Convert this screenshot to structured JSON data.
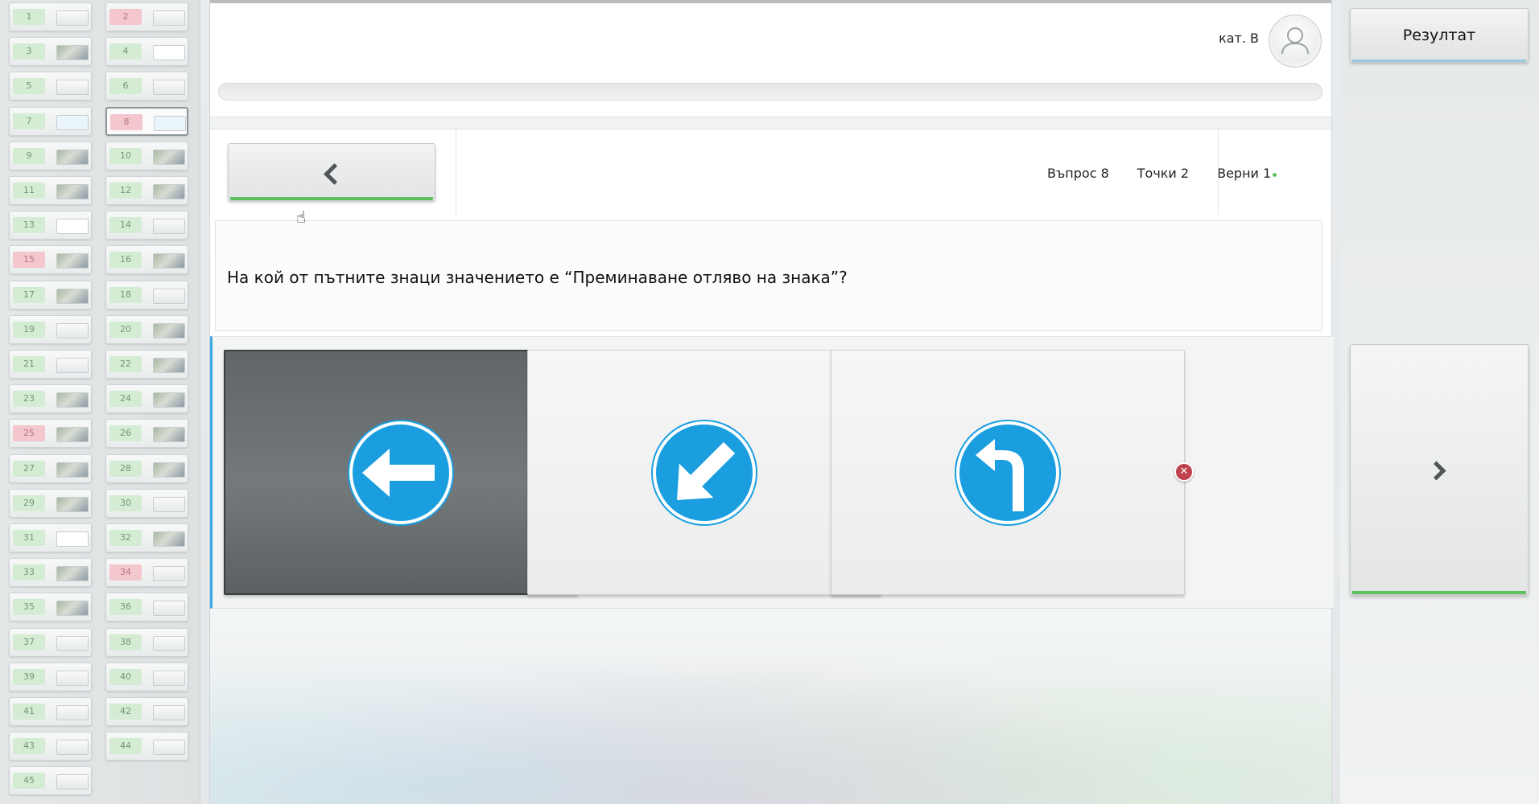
{
  "sidebar": {
    "tiles": [
      {
        "num": "1",
        "state": "green",
        "thumb": "plain"
      },
      {
        "num": "2",
        "state": "red",
        "thumb": "plain"
      },
      {
        "num": "3",
        "state": "green",
        "thumb": "pic"
      },
      {
        "num": "4",
        "state": "green",
        "thumb": "sign"
      },
      {
        "num": "5",
        "state": "green",
        "thumb": "plain"
      },
      {
        "num": "6",
        "state": "green",
        "thumb": "plain"
      },
      {
        "num": "7",
        "state": "green",
        "thumb": "blue"
      },
      {
        "num": "8",
        "state": "red",
        "thumb": "blue",
        "active": true
      },
      {
        "num": "9",
        "state": "green",
        "thumb": "pic"
      },
      {
        "num": "10",
        "state": "green",
        "thumb": "pic"
      },
      {
        "num": "11",
        "state": "green",
        "thumb": "pic"
      },
      {
        "num": "12",
        "state": "green",
        "thumb": "pic"
      },
      {
        "num": "13",
        "state": "green",
        "thumb": "sign"
      },
      {
        "num": "14",
        "state": "green",
        "thumb": "plain"
      },
      {
        "num": "15",
        "state": "red",
        "thumb": "pic"
      },
      {
        "num": "16",
        "state": "green",
        "thumb": "pic"
      },
      {
        "num": "17",
        "state": "green",
        "thumb": "pic"
      },
      {
        "num": "18",
        "state": "green",
        "thumb": "plain"
      },
      {
        "num": "19",
        "state": "green",
        "thumb": "plain"
      },
      {
        "num": "20",
        "state": "green",
        "thumb": "pic"
      },
      {
        "num": "21",
        "state": "green",
        "thumb": "plain"
      },
      {
        "num": "22",
        "state": "green",
        "thumb": "pic"
      },
      {
        "num": "23",
        "state": "green",
        "thumb": "pic"
      },
      {
        "num": "24",
        "state": "green",
        "thumb": "pic"
      },
      {
        "num": "25",
        "state": "red",
        "thumb": "pic"
      },
      {
        "num": "26",
        "state": "green",
        "thumb": "pic"
      },
      {
        "num": "27",
        "state": "green",
        "thumb": "pic"
      },
      {
        "num": "28",
        "state": "green",
        "thumb": "pic"
      },
      {
        "num": "29",
        "state": "green",
        "thumb": "pic"
      },
      {
        "num": "30",
        "state": "green",
        "thumb": "plain"
      },
      {
        "num": "31",
        "state": "green",
        "thumb": "sign"
      },
      {
        "num": "32",
        "state": "green",
        "thumb": "pic"
      },
      {
        "num": "33",
        "state": "green",
        "thumb": "pic"
      },
      {
        "num": "34",
        "state": "red",
        "thumb": "plain"
      },
      {
        "num": "35",
        "state": "green",
        "thumb": "pic"
      },
      {
        "num": "36",
        "state": "green",
        "thumb": "plain"
      },
      {
        "num": "37",
        "state": "green",
        "thumb": "plain"
      },
      {
        "num": "38",
        "state": "green",
        "thumb": "plain"
      },
      {
        "num": "39",
        "state": "green",
        "thumb": "plain"
      },
      {
        "num": "40",
        "state": "green",
        "thumb": "plain"
      },
      {
        "num": "41",
        "state": "green",
        "thumb": "plain"
      },
      {
        "num": "42",
        "state": "green",
        "thumb": "plain"
      },
      {
        "num": "43",
        "state": "green",
        "thumb": "plain"
      },
      {
        "num": "44",
        "state": "green",
        "thumb": "plain"
      },
      {
        "num": "45",
        "state": "green",
        "thumb": "plain"
      }
    ]
  },
  "header": {
    "category": "кат. B"
  },
  "nav": {
    "question_label": "Въпрос 8",
    "points_label": "Точки 2",
    "correct_label": "Верни 1"
  },
  "question": {
    "text": "На кой от пътните знаци значението е “Преминаване отляво на знака”?"
  },
  "answers": [
    {
      "icon": "arrow-left-sign-icon",
      "selected": true,
      "mark": "wrong"
    },
    {
      "icon": "arrow-down-left-sign-icon",
      "selected": false,
      "mark": "right"
    },
    {
      "icon": "turn-left-sign-icon",
      "selected": false,
      "mark": "wrong"
    }
  ],
  "right_panel": {
    "result_label": "Резултат"
  },
  "colors": {
    "accent_green": "#5cc25e",
    "sign_blue": "#1a9ee0",
    "wrong_red": "#c0424f",
    "right_green": "#2fae44"
  }
}
